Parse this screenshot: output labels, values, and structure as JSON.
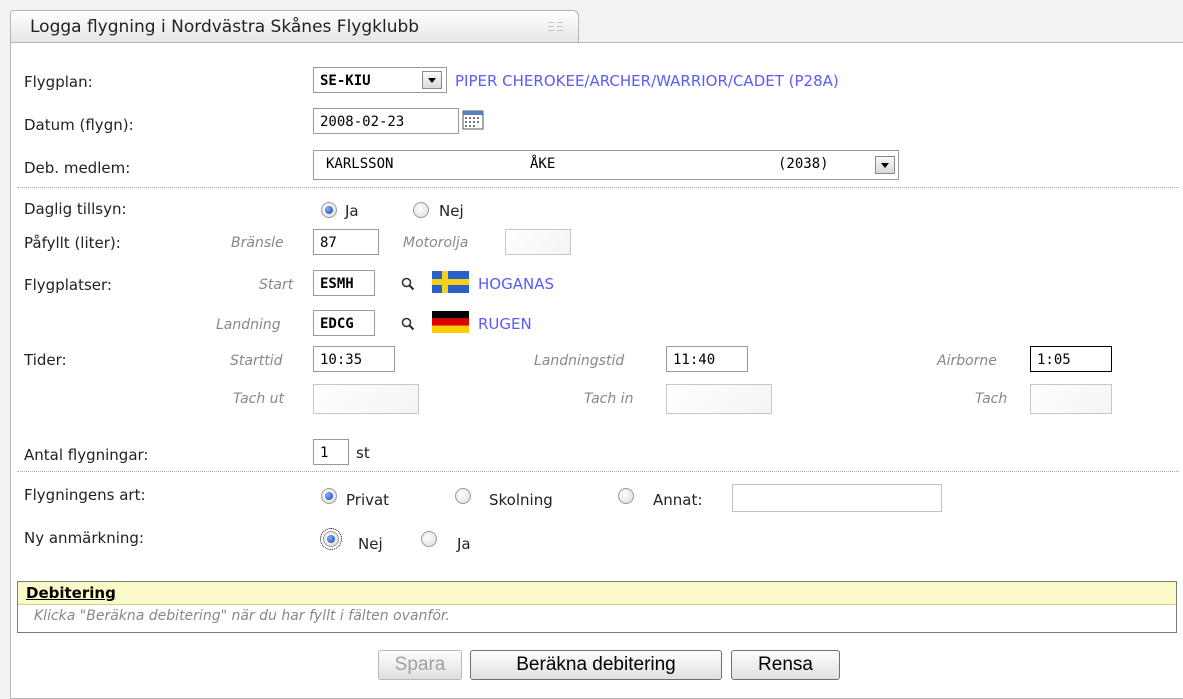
{
  "tab": {
    "title": "Logga flygning i Nordvästra Skånes Flygklubb",
    "icon": "list-icon"
  },
  "form": {
    "flygplan": {
      "label": "Flygplan:",
      "value": "SE-KIU",
      "type_link": "PIPER CHEROKEE/ARCHER/WARRIOR/CADET (P28A)"
    },
    "datum": {
      "label": "Datum (flygn):",
      "value": "2008-02-23",
      "icon": "calendar-icon"
    },
    "deb_medlem": {
      "label": "Deb. medlem:",
      "surname": "KARLSSON",
      "firstname": "ÅKE",
      "number": "(2038)"
    },
    "daglig_tillsyn": {
      "label": "Daglig tillsyn:",
      "options": [
        "Ja",
        "Nej"
      ],
      "selected": "Ja"
    },
    "pafyllt": {
      "label": "Påfyllt (liter):",
      "bransle_label": "Bränsle",
      "bransle_value": "87",
      "motorolja_label": "Motorolja",
      "motorolja_value": ""
    },
    "flygplatser": {
      "label": "Flygplatser:",
      "start": {
        "label": "Start",
        "code": "ESMH",
        "name": "HOGANAS",
        "flag": "sweden-flag"
      },
      "landning": {
        "label": "Landning",
        "code": "EDCG",
        "name": "RUGEN",
        "flag": "germany-flag"
      }
    },
    "tider": {
      "label": "Tider:",
      "starttid_label": "Starttid",
      "starttid": "10:35",
      "landningstid_label": "Landningstid",
      "landningstid": "11:40",
      "airborne_label": "Airborne",
      "airborne": "1:05",
      "tach_ut_label": "Tach ut",
      "tach_ut": "",
      "tach_in_label": "Tach in",
      "tach_in": "",
      "tach_label": "Tach",
      "tach": ""
    },
    "antal": {
      "label": "Antal flygningar:",
      "value": "1",
      "unit": "st"
    },
    "art": {
      "label": "Flygningens art:",
      "options": [
        "Privat",
        "Skolning",
        "Annat:"
      ],
      "selected": "Privat",
      "annat_value": ""
    },
    "anmarkning": {
      "label": "Ny anmärkning:",
      "options": [
        "Nej",
        "Ja"
      ],
      "selected": "Nej"
    }
  },
  "debitering": {
    "title": "Debitering",
    "hint": "Klicka \"Beräkna debitering\" när du har fyllt i fälten ovanför."
  },
  "buttons": {
    "spara": "Spara",
    "berakna": "Beräkna debitering",
    "rensa": "Rensa"
  }
}
